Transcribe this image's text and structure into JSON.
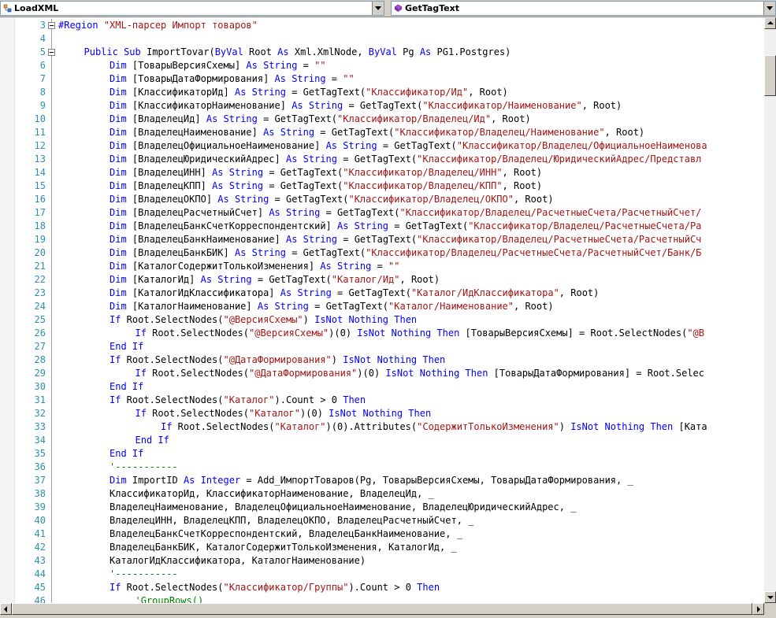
{
  "toolbar": {
    "left_combo": {
      "text": "LoadXML",
      "icon": "class-icon"
    },
    "right_combo": {
      "text": "GetTagText",
      "icon": "method-icon"
    }
  },
  "colors": {
    "keyword": "#0000ff",
    "string": "#a31515",
    "comment": "#008000",
    "line_number": "#2b91af"
  },
  "editor": {
    "lines": [
      {
        "num": "3",
        "indent": 0,
        "fold": true,
        "parts": [
          [
            "k",
            "#Region "
          ],
          [
            "s",
            "\"XML-парсер Импорт товаров\""
          ]
        ]
      },
      {
        "num": "4",
        "indent": 0,
        "parts": []
      },
      {
        "num": "5",
        "indent": 1,
        "fold": true,
        "parts": [
          [
            "k",
            "Public Sub "
          ],
          [
            "n",
            "ImportTovar("
          ],
          [
            "k",
            "ByVal"
          ],
          [
            "n",
            " Root "
          ],
          [
            "k",
            "As"
          ],
          [
            "n",
            " Xml.XmlNode, "
          ],
          [
            "k",
            "ByVal"
          ],
          [
            "n",
            " Pg "
          ],
          [
            "k",
            "As"
          ],
          [
            "n",
            " PG1.Postgres)"
          ]
        ]
      },
      {
        "num": "6",
        "indent": 2,
        "parts": [
          [
            "k",
            "Dim"
          ],
          [
            "n",
            " [ТоварыВерсияСхемы] "
          ],
          [
            "k",
            "As String"
          ],
          [
            "n",
            " = "
          ],
          [
            "s",
            "\"\""
          ]
        ]
      },
      {
        "num": "7",
        "indent": 2,
        "parts": [
          [
            "k",
            "Dim"
          ],
          [
            "n",
            " [ТоварыДатаФормирования] "
          ],
          [
            "k",
            "As String"
          ],
          [
            "n",
            " = "
          ],
          [
            "s",
            "\"\""
          ]
        ]
      },
      {
        "num": "8",
        "indent": 2,
        "parts": [
          [
            "k",
            "Dim"
          ],
          [
            "n",
            " [КлассификаторИд] "
          ],
          [
            "k",
            "As String"
          ],
          [
            "n",
            " = GetTagText("
          ],
          [
            "s",
            "\"Классификатор/Ид\""
          ],
          [
            "n",
            ", Root)"
          ]
        ]
      },
      {
        "num": "9",
        "indent": 2,
        "parts": [
          [
            "k",
            "Dim"
          ],
          [
            "n",
            " [КлассификаторНаименование] "
          ],
          [
            "k",
            "As String"
          ],
          [
            "n",
            " = GetTagText("
          ],
          [
            "s",
            "\"Классификатор/Наименование\""
          ],
          [
            "n",
            ", Root)"
          ]
        ]
      },
      {
        "num": "10",
        "indent": 2,
        "parts": [
          [
            "k",
            "Dim"
          ],
          [
            "n",
            " [ВладелецИд] "
          ],
          [
            "k",
            "As String"
          ],
          [
            "n",
            " = GetTagText("
          ],
          [
            "s",
            "\"Классификатор/Владелец/Ид\""
          ],
          [
            "n",
            ", Root)"
          ]
        ]
      },
      {
        "num": "11",
        "indent": 2,
        "parts": [
          [
            "k",
            "Dim"
          ],
          [
            "n",
            " [ВладелецНаименование] "
          ],
          [
            "k",
            "As String"
          ],
          [
            "n",
            " = GetTagText("
          ],
          [
            "s",
            "\"Классификатор/Владелец/Наименование\""
          ],
          [
            "n",
            ", Root)"
          ]
        ]
      },
      {
        "num": "12",
        "indent": 2,
        "parts": [
          [
            "k",
            "Dim"
          ],
          [
            "n",
            " [ВладелецОфициальноеНаименование] "
          ],
          [
            "k",
            "As String"
          ],
          [
            "n",
            " = GetTagText("
          ],
          [
            "s",
            "\"Классификатор/Владелец/ОфициальноеНаименова"
          ]
        ]
      },
      {
        "num": "13",
        "indent": 2,
        "parts": [
          [
            "k",
            "Dim"
          ],
          [
            "n",
            " [ВладелецЮридическийАдрес] "
          ],
          [
            "k",
            "As String"
          ],
          [
            "n",
            " = GetTagText("
          ],
          [
            "s",
            "\"Классификатор/Владелец/ЮридическийАдрес/Представл"
          ]
        ]
      },
      {
        "num": "14",
        "indent": 2,
        "parts": [
          [
            "k",
            "Dim"
          ],
          [
            "n",
            " [ВладелецИНН] "
          ],
          [
            "k",
            "As String"
          ],
          [
            "n",
            " = GetTagText("
          ],
          [
            "s",
            "\"Классификатор/Владелец/ИНН\""
          ],
          [
            "n",
            ", Root)"
          ]
        ]
      },
      {
        "num": "15",
        "indent": 2,
        "parts": [
          [
            "k",
            "Dim"
          ],
          [
            "n",
            " [ВладелецКПП] "
          ],
          [
            "k",
            "As String"
          ],
          [
            "n",
            " = GetTagText("
          ],
          [
            "s",
            "\"Классификатор/Владелец/КПП\""
          ],
          [
            "n",
            ", Root)"
          ]
        ]
      },
      {
        "num": "16",
        "indent": 2,
        "parts": [
          [
            "k",
            "Dim"
          ],
          [
            "n",
            " [ВладелецОКПО] "
          ],
          [
            "k",
            "As String"
          ],
          [
            "n",
            " = GetTagText("
          ],
          [
            "s",
            "\"Классификатор/Владелец/ОКПО\""
          ],
          [
            "n",
            ", Root)"
          ]
        ]
      },
      {
        "num": "17",
        "indent": 2,
        "parts": [
          [
            "k",
            "Dim"
          ],
          [
            "n",
            " [ВладелецРасчетныйСчет] "
          ],
          [
            "k",
            "As String"
          ],
          [
            "n",
            " = GetTagText("
          ],
          [
            "s",
            "\"Классификатор/Владелец/РасчетныеСчета/РасчетныйСчет/"
          ]
        ]
      },
      {
        "num": "18",
        "indent": 2,
        "parts": [
          [
            "k",
            "Dim"
          ],
          [
            "n",
            " [ВладелецБанкСчетКорреспондентский] "
          ],
          [
            "k",
            "As String"
          ],
          [
            "n",
            " = GetTagText("
          ],
          [
            "s",
            "\"Классификатор/Владелец/РасчетныеСчета/Ра"
          ]
        ]
      },
      {
        "num": "19",
        "indent": 2,
        "parts": [
          [
            "k",
            "Dim"
          ],
          [
            "n",
            " [ВладелецБанкНаименование] "
          ],
          [
            "k",
            "As String"
          ],
          [
            "n",
            " = GetTagText("
          ],
          [
            "s",
            "\"Классификатор/Владелец/РасчетныеСчета/РасчетныйСч"
          ]
        ]
      },
      {
        "num": "20",
        "indent": 2,
        "parts": [
          [
            "k",
            "Dim"
          ],
          [
            "n",
            " [ВладелецБанкБИК] "
          ],
          [
            "k",
            "As String"
          ],
          [
            "n",
            " = GetTagText("
          ],
          [
            "s",
            "\"Классификатор/Владелец/РасчетныеСчета/РасчетныйСчет/Банк/Б"
          ]
        ]
      },
      {
        "num": "21",
        "indent": 2,
        "parts": [
          [
            "k",
            "Dim"
          ],
          [
            "n",
            " [КаталогСодержитТолькоИзменения] "
          ],
          [
            "k",
            "As String"
          ],
          [
            "n",
            " = "
          ],
          [
            "s",
            "\"\""
          ]
        ]
      },
      {
        "num": "22",
        "indent": 2,
        "parts": [
          [
            "k",
            "Dim"
          ],
          [
            "n",
            " [КаталогИд] "
          ],
          [
            "k",
            "As String"
          ],
          [
            "n",
            " = GetTagText("
          ],
          [
            "s",
            "\"Каталог/Ид\""
          ],
          [
            "n",
            ", Root)"
          ]
        ]
      },
      {
        "num": "23",
        "indent": 2,
        "parts": [
          [
            "k",
            "Dim"
          ],
          [
            "n",
            " [КаталогИдКлассификатора] "
          ],
          [
            "k",
            "As String"
          ],
          [
            "n",
            " = GetTagText("
          ],
          [
            "s",
            "\"Каталог/ИдКлассификатора\""
          ],
          [
            "n",
            ", Root)"
          ]
        ]
      },
      {
        "num": "24",
        "indent": 2,
        "parts": [
          [
            "k",
            "Dim"
          ],
          [
            "n",
            " [КаталогНаименование] "
          ],
          [
            "k",
            "As String"
          ],
          [
            "n",
            " = GetTagText("
          ],
          [
            "s",
            "\"Каталог/Наименование\""
          ],
          [
            "n",
            ", Root)"
          ]
        ]
      },
      {
        "num": "25",
        "indent": 2,
        "parts": [
          [
            "k",
            "If"
          ],
          [
            "n",
            " Root.SelectNodes("
          ],
          [
            "s",
            "\"@ВерсияСхемы\""
          ],
          [
            "n",
            ") "
          ],
          [
            "k",
            "IsNot Nothing Then"
          ]
        ]
      },
      {
        "num": "26",
        "indent": 3,
        "parts": [
          [
            "k",
            "If"
          ],
          [
            "n",
            " Root.SelectNodes("
          ],
          [
            "s",
            "\"@ВерсияСхемы\""
          ],
          [
            "n",
            ")(0) "
          ],
          [
            "k",
            "IsNot Nothing Then"
          ],
          [
            "n",
            " [ТоварыВерсияСхемы] = Root.SelectNodes("
          ],
          [
            "s",
            "\"@В"
          ]
        ]
      },
      {
        "num": "27",
        "indent": 2,
        "parts": [
          [
            "k",
            "End If"
          ]
        ]
      },
      {
        "num": "28",
        "indent": 2,
        "parts": [
          [
            "k",
            "If"
          ],
          [
            "n",
            " Root.SelectNodes("
          ],
          [
            "s",
            "\"@ДатаФормирования\""
          ],
          [
            "n",
            ") "
          ],
          [
            "k",
            "IsNot Nothing Then"
          ]
        ]
      },
      {
        "num": "29",
        "indent": 3,
        "parts": [
          [
            "k",
            "If"
          ],
          [
            "n",
            " Root.SelectNodes("
          ],
          [
            "s",
            "\"@ДатаФормирования\""
          ],
          [
            "n",
            ")(0) "
          ],
          [
            "k",
            "IsNot Nothing Then"
          ],
          [
            "n",
            " [ТоварыДатаФормирования] = Root.Selec"
          ]
        ]
      },
      {
        "num": "30",
        "indent": 2,
        "parts": [
          [
            "k",
            "End If"
          ]
        ]
      },
      {
        "num": "31",
        "indent": 2,
        "parts": [
          [
            "k",
            "If"
          ],
          [
            "n",
            " Root.SelectNodes("
          ],
          [
            "s",
            "\"Каталог\""
          ],
          [
            "n",
            ").Count > 0 "
          ],
          [
            "k",
            "Then"
          ]
        ]
      },
      {
        "num": "32",
        "indent": 3,
        "parts": [
          [
            "k",
            "If"
          ],
          [
            "n",
            " Root.SelectNodes("
          ],
          [
            "s",
            "\"Каталог\""
          ],
          [
            "n",
            ")(0) "
          ],
          [
            "k",
            "IsNot Nothing Then"
          ]
        ]
      },
      {
        "num": "33",
        "indent": 4,
        "parts": [
          [
            "k",
            "If"
          ],
          [
            "n",
            " Root.SelectNodes("
          ],
          [
            "s",
            "\"Каталог\""
          ],
          [
            "n",
            ")(0).Attributes("
          ],
          [
            "s",
            "\"СодержитТолькоИзменения\""
          ],
          [
            "n",
            ") "
          ],
          [
            "k",
            "IsNot Nothing Then"
          ],
          [
            "n",
            " [Ката"
          ]
        ]
      },
      {
        "num": "34",
        "indent": 3,
        "parts": [
          [
            "k",
            "End If"
          ]
        ]
      },
      {
        "num": "35",
        "indent": 2,
        "parts": [
          [
            "k",
            "End If"
          ]
        ]
      },
      {
        "num": "36",
        "indent": 2,
        "parts": [
          [
            "c",
            "'-----------"
          ]
        ]
      },
      {
        "num": "37",
        "indent": 2,
        "parts": [
          [
            "k",
            "Dim"
          ],
          [
            "n",
            " ImportID "
          ],
          [
            "k",
            "As Integer"
          ],
          [
            "n",
            " = Add_ИмпортТоваров(Pg, ТоварыВерсияСхемы, ТоварыДатаФормирования, _"
          ]
        ]
      },
      {
        "num": "38",
        "indent": 2,
        "parts": [
          [
            "n",
            "КлассификаторИд, КлассификаторНаименование, ВладелецИд, _"
          ]
        ]
      },
      {
        "num": "39",
        "indent": 2,
        "parts": [
          [
            "n",
            "ВладелецНаименование, ВладелецОфициальноеНаименование, ВладелецЮридическийАдрес, _"
          ]
        ]
      },
      {
        "num": "40",
        "indent": 2,
        "parts": [
          [
            "n",
            "ВладелецИНН, ВладелецКПП, ВладелецОКПО, ВладелецРасчетныйСчет, _"
          ]
        ]
      },
      {
        "num": "41",
        "indent": 2,
        "parts": [
          [
            "n",
            "ВладелецБанкСчетКорреспондентский, ВладелецБанкНаименование, _"
          ]
        ]
      },
      {
        "num": "42",
        "indent": 2,
        "parts": [
          [
            "n",
            "ВладелецБанкБИК, КаталогСодержитТолькоИзменения, КаталогИд, _"
          ]
        ]
      },
      {
        "num": "43",
        "indent": 2,
        "parts": [
          [
            "n",
            "КаталогИдКлассификатора, КаталогНаименование)"
          ]
        ]
      },
      {
        "num": "44",
        "indent": 2,
        "parts": [
          [
            "c",
            "'-----------"
          ]
        ]
      },
      {
        "num": "45",
        "indent": 2,
        "parts": [
          [
            "k",
            "If"
          ],
          [
            "n",
            " Root.SelectNodes("
          ],
          [
            "s",
            "\"Классификатор/Группы\""
          ],
          [
            "n",
            ").Count > 0 "
          ],
          [
            "k",
            "Then"
          ]
        ]
      },
      {
        "num": "46",
        "indent": 3,
        "parts": [
          [
            "c",
            "'GroupRows()"
          ]
        ]
      }
    ]
  },
  "scrollbars": {
    "vertical_position": 0.05,
    "horizontal_position": 0.0
  }
}
